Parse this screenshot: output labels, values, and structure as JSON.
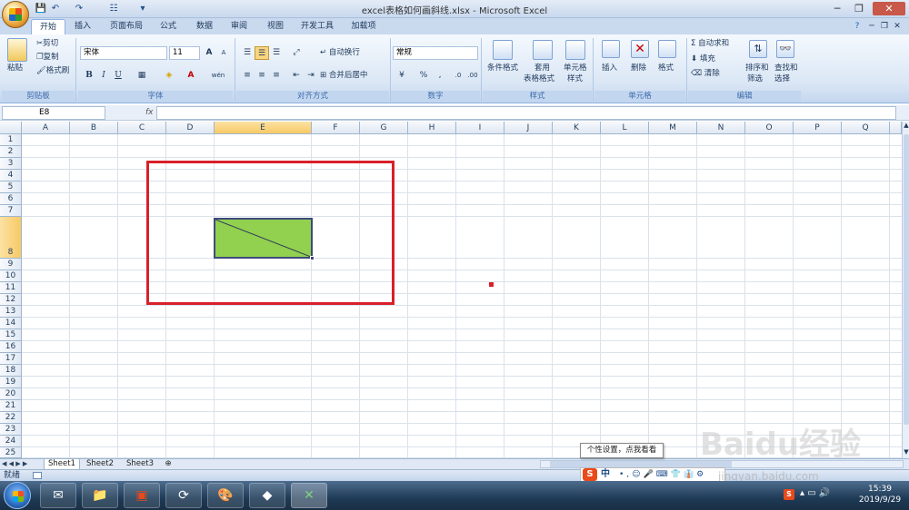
{
  "window": {
    "title": "excel表格如何画斜线.xlsx - Microsoft Excel",
    "qat": [
      "💾",
      "↶",
      "↷",
      "☷",
      "▾"
    ],
    "controls": [
      "─",
      "❐",
      "✕"
    ]
  },
  "tabs": [
    "开始",
    "插入",
    "页面布局",
    "公式",
    "数据",
    "审阅",
    "视图",
    "开发工具",
    "加载项"
  ],
  "help_icons": [
    "?",
    "─",
    "❐",
    "✕"
  ],
  "ribbon": {
    "clipboard": {
      "paste": "粘贴",
      "cut": "剪切",
      "copy": "复制",
      "format_painter": "格式刷",
      "label": "剪贴板"
    },
    "font": {
      "name": "宋体",
      "size": "11",
      "bold": "B",
      "italic": "I",
      "underline": "U",
      "grow": "A",
      "shrink": "A",
      "color": "A",
      "wen": "wén",
      "label": "字体"
    },
    "alignment": {
      "wrap": "自动换行",
      "merge": "合并后居中",
      "label": "对齐方式"
    },
    "number": {
      "format": "常规",
      "percent": "%",
      "comma": ",",
      "label": "数字"
    },
    "styles": {
      "conditional": "条件格式",
      "table": "套用",
      "table2": "表格格式",
      "cell_styles": "单元格",
      "cell_styles2": "样式",
      "label": "样式"
    },
    "cells": {
      "insert": "插入",
      "delete": "删除",
      "format": "格式",
      "label": "单元格"
    },
    "editing": {
      "autosum": "Σ 自动求和",
      "fill": "填充",
      "clear": "清除",
      "sort": "排序和",
      "sort2": "筛选",
      "find": "查找和",
      "find2": "选择",
      "label": "编辑"
    }
  },
  "formula_bar": {
    "cell_ref": "E8",
    "fx": "fx"
  },
  "columns": [
    "A",
    "B",
    "C",
    "D",
    "E",
    "F",
    "G",
    "H",
    "I",
    "J",
    "K",
    "L",
    "M",
    "N",
    "O",
    "P",
    "Q"
  ],
  "rows": [
    "1",
    "2",
    "3",
    "4",
    "5",
    "6",
    "7",
    "8",
    "9",
    "10",
    "11",
    "12",
    "13",
    "14",
    "15",
    "16",
    "17",
    "18",
    "19",
    "20",
    "21",
    "22",
    "23",
    "24",
    "25"
  ],
  "sheets": [
    "Sheet1",
    "Sheet2",
    "Sheet3"
  ],
  "status": {
    "ready": "就绪"
  },
  "tooltip": "个性设置，点我看看",
  "ime": {
    "brand": "S",
    "lang": "中"
  },
  "watermark": {
    "text": "Baidu经验",
    "url": "jingyan.baidu.com"
  },
  "clock": {
    "time": "15:39",
    "date": "2019/9/29"
  },
  "colors": {
    "accent": "#d9202a",
    "cell_fill": "#92d050",
    "selected_header": "#f8c965"
  }
}
